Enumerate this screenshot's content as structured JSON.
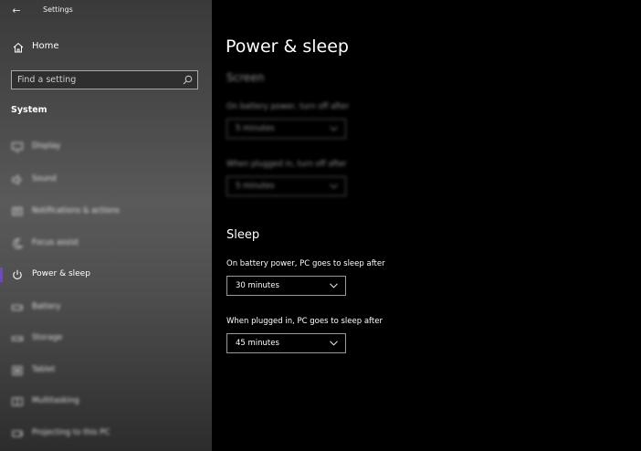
{
  "window": {
    "title": "Settings",
    "back_glyph": "←"
  },
  "sidebar": {
    "home_label": "Home",
    "search_placeholder": "Find a setting",
    "section_label": "System",
    "items": [
      {
        "label": "Display",
        "icon": "monitor-icon"
      },
      {
        "label": "Sound",
        "icon": "speaker-icon"
      },
      {
        "label": "Notifications & actions",
        "icon": "notification-icon"
      },
      {
        "label": "Focus assist",
        "icon": "moon-icon"
      },
      {
        "label": "Power & sleep",
        "icon": "power-icon",
        "active": true
      },
      {
        "label": "Battery",
        "icon": "battery-icon"
      },
      {
        "label": "Storage",
        "icon": "storage-icon"
      },
      {
        "label": "Tablet",
        "icon": "tablet-icon"
      },
      {
        "label": "Multitasking",
        "icon": "multitasking-icon"
      },
      {
        "label": "Projecting to this PC",
        "icon": "projecting-icon"
      }
    ],
    "accent_color": "#6a4fb0"
  },
  "main": {
    "title": "Power & sleep",
    "screen": {
      "heading": "Screen",
      "battery_label": "On battery power, turn off after",
      "battery_value": "5 minutes",
      "plugged_label": "When plugged in, turn off after",
      "plugged_value": "5 minutes"
    },
    "sleep": {
      "heading": "Sleep",
      "battery_label": "On battery power, PC goes to sleep after",
      "battery_value": "30 minutes",
      "plugged_label": "When plugged in, PC goes to sleep after",
      "plugged_value": "45 minutes"
    }
  }
}
